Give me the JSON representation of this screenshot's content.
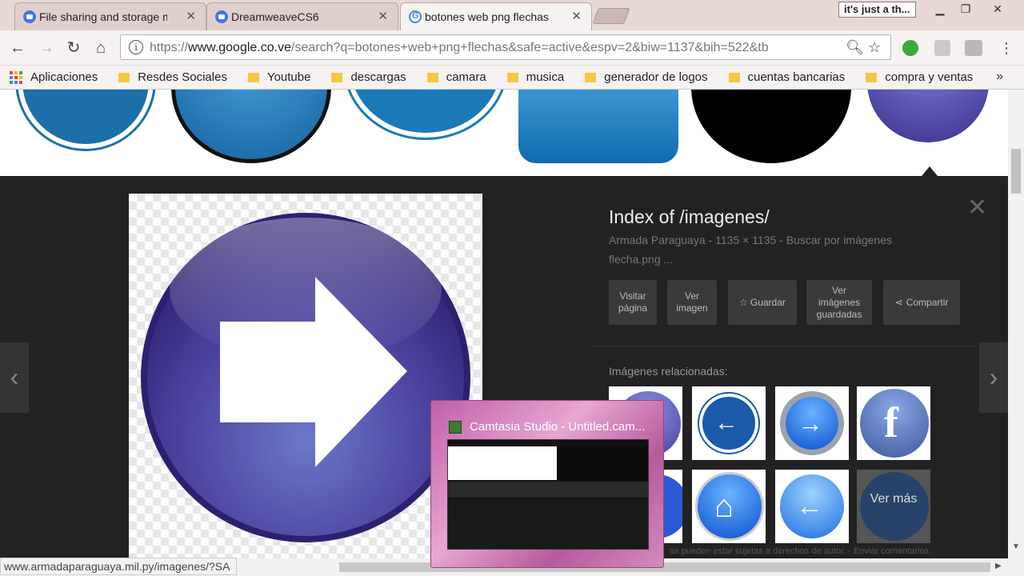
{
  "tabs": [
    {
      "title": "File sharing and storage m",
      "favicon": "blue",
      "state": "inactive"
    },
    {
      "title": "DreamweaveCS6",
      "favicon": "blue",
      "state": "inactive"
    },
    {
      "title": "botones web png flechas",
      "favicon": "google",
      "state": "active"
    }
  ],
  "window": {
    "user_label": "it's just a th..."
  },
  "address": {
    "domain": "www.google.co.ve",
    "prefix": "https://",
    "path": "/search?q=botones+web+png+flechas&safe=active&espv=2&biw=1137&bih=522&tb"
  },
  "bookmarks": {
    "apps": "Aplicaciones",
    "items": [
      "Resdes Sociales",
      "Youtube",
      "descargas",
      "camara",
      "musica",
      "generador de logos",
      "cuentas bancarias",
      "compra y ventas"
    ],
    "more": "»"
  },
  "panel": {
    "title": "Index of /imagenes/",
    "source": "Armada Paraguaya",
    "dimensions": "1135 × 1135",
    "search_by": "Buscar por imágenes",
    "filename": "flecha.png ...",
    "actions": [
      "Visitar página",
      "Ver imagen",
      "Guardar",
      "Ver imágenes guardadas",
      "Compartir"
    ],
    "related_label": "Imágenes relacionadas:",
    "ver_mas": "Ver más",
    "legal": "as pueden estar sujetas a derechos de autor. - Enviar comentarios"
  },
  "status_url": "www.armadaparaguaya.mil.py/imagenes/?SA",
  "camtasia": {
    "title": "Camtasia Studio - Untitled.cam..."
  },
  "colors": {
    "tab_strip": "#e8d9d6",
    "panel_bg": "#222222",
    "purple_button": "#4b3f9e",
    "camtasia_pink": "#c15fa8"
  }
}
